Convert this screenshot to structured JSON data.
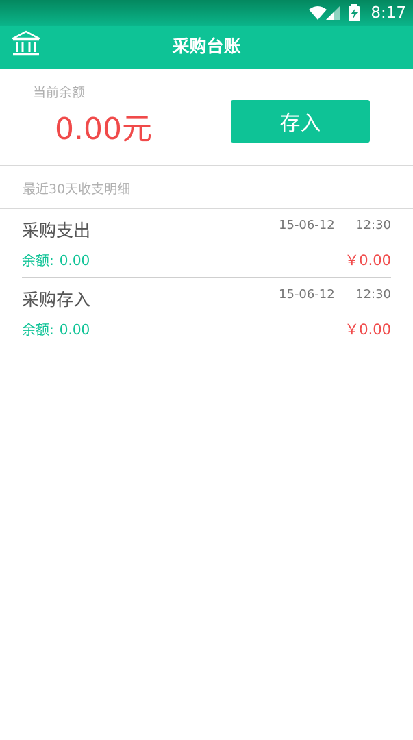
{
  "status_bar": {
    "time": "8:17",
    "icons": [
      "wifi-icon",
      "signal-icon",
      "battery-charging-icon"
    ]
  },
  "app_bar": {
    "title": "采购台账",
    "left_icon": "bank-icon"
  },
  "balance": {
    "label": "当前余额",
    "value": "0.00元",
    "deposit_label": "存入"
  },
  "records_section": {
    "title": "最近30天收支明细",
    "items": [
      {
        "title": "采购支出",
        "date": "15-06-12",
        "time": "12:30",
        "balance_label": "余额:",
        "balance_value": "0.00",
        "amount": "￥0.00"
      },
      {
        "title": "采购存入",
        "date": "15-06-12",
        "time": "12:30",
        "balance_label": "余额:",
        "balance_value": "0.00",
        "amount": "￥0.00"
      }
    ]
  },
  "colors": {
    "primary": "#0ec396",
    "status_bar": "#04885f",
    "negative": "#f04a4a",
    "label_gray": "#b0b0b0"
  }
}
